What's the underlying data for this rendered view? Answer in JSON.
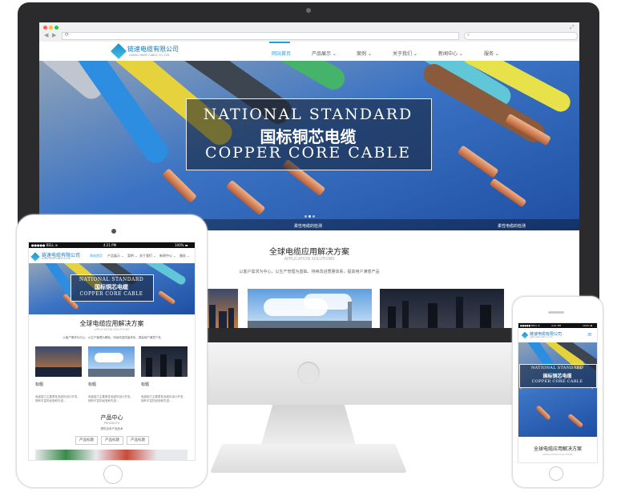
{
  "site": {
    "company_name": "链速电缆有限公司",
    "company_en": "LIANSU WIRE CABLE CO.,LTD",
    "nav": [
      {
        "label": "网站首页",
        "active": true
      },
      {
        "label": "产品展示 ⌄"
      },
      {
        "label": "案例 ⌄"
      },
      {
        "label": "关于我们 ⌄"
      },
      {
        "label": "新闻中心 ⌄"
      },
      {
        "label": "服务 ⌄"
      }
    ],
    "hero": {
      "line1": "NATIONAL STANDARD",
      "line2": "国标铜芯电缆",
      "line3": "COPPER CORE CABLE",
      "caption_left": "柔性电缆的检测",
      "caption_right": "柔性电缆的检测"
    },
    "solutions": {
      "title": "全球电缆应用解决方案",
      "subtitle": "APPLICATION SOLUTIONS",
      "desc": "以客户需求为中心，以生产管理为基础，持续改进质量体系，提高用户满意产品",
      "items": [
        {
          "label": "标题",
          "text": "电缆能力主要柔性电缆的设计开发，拥有丰富的经验和先进..."
        },
        {
          "label": "标题",
          "text": "电缆能力主要柔性电缆的设计开发，拥有丰富的经验和先进..."
        },
        {
          "label": "标题",
          "text": "电缆能力主要柔性电缆的设计开发，拥有丰富的经验和先进..."
        }
      ]
    },
    "products": {
      "title": "产品中心",
      "subtitle": "PRODUCTS",
      "desc": "提供全系产品技术",
      "buttons": [
        "产品标题",
        "产品标题",
        "产品标题"
      ]
    }
  },
  "tablet_status": {
    "carrier": "●●●●● BELL ≋",
    "time": "4:21 PM",
    "battery": "100% ▬"
  },
  "phone_status": {
    "carrier": "●●●●● BELL ≋",
    "time": "4:21 PM",
    "battery": "100% ▬"
  },
  "colors": {
    "accent": "#27a1db",
    "logo_blue": "#1a74b3",
    "hero_blue": "#1f5fb8"
  },
  "icons": [
    "back-arrow-icon",
    "forward-arrow-icon",
    "reload-icon",
    "search-icon",
    "expand-icon",
    "menu-icon"
  ]
}
